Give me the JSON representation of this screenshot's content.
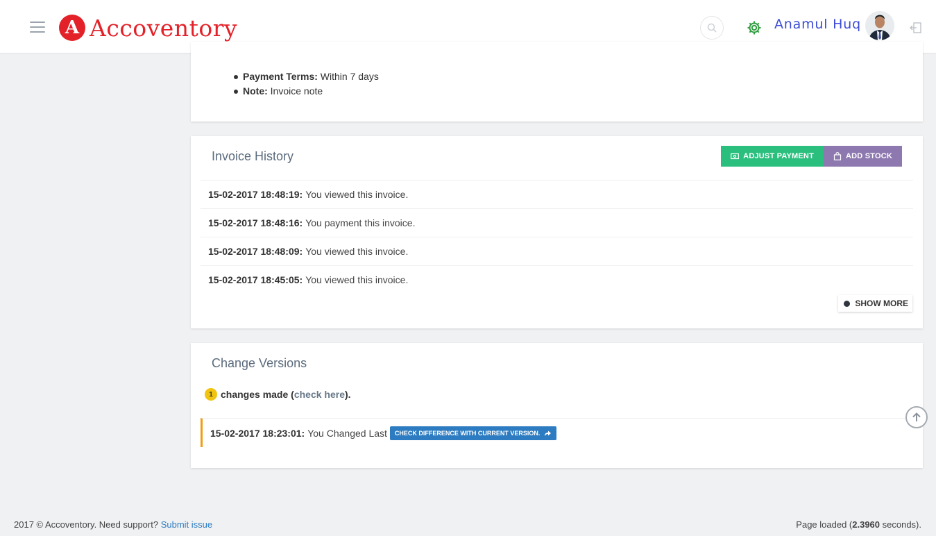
{
  "header": {
    "app_name": "Accoventory",
    "logo_letter": "A",
    "user_name": "Anamul Huq",
    "icons": {
      "menu": "hamburger-menu-icon",
      "search": "search-icon",
      "settings": "gear-icon",
      "logout": "logout-icon"
    }
  },
  "invoice_terms": {
    "items": [
      {
        "label": "Payment Terms:",
        "value": "Within 7 days"
      },
      {
        "label": "Note:",
        "value": "Invoice note"
      }
    ]
  },
  "invoice_history": {
    "title": "Invoice History",
    "adjust_payment_label": "ADJUST PAYMENT",
    "add_stock_label": "ADD STOCK",
    "rows": [
      {
        "timestamp": "15-02-2017 18:48:19:",
        "text": "You viewed this invoice."
      },
      {
        "timestamp": "15-02-2017 18:48:16:",
        "text": "You payment this invoice."
      },
      {
        "timestamp": "15-02-2017 18:48:09:",
        "text": "You viewed this invoice."
      },
      {
        "timestamp": "15-02-2017 18:45:05:",
        "text": "You viewed this invoice."
      }
    ],
    "show_more_label": "SHOW MORE"
  },
  "change_versions": {
    "title": "Change Versions",
    "count": "1",
    "changes_prefix": "changes made (",
    "check_here_label": "check here",
    "changes_suffix": ").",
    "version_timestamp": "15-02-2017 18:23:01:",
    "version_text": "You Changed Last",
    "diff_button_label": "CHECK DIFFERENCE WITH CURRENT VERSION."
  },
  "footer": {
    "copyright": "2017 © Accoventory. Need support?",
    "support_link": "Submit issue",
    "load_prefix": "Page loaded (",
    "load_time": "2.3960",
    "load_suffix": " seconds)."
  },
  "colors": {
    "brand_red": "#e32129",
    "user_name_blue": "#3b4bd8",
    "adjust_green": "#2bbf7e",
    "add_stock_purple": "#8e78b0",
    "diff_blue": "#2d7cc1",
    "version_accent_orange": "#f39c12",
    "badge_yellow": "#f1c40f"
  }
}
